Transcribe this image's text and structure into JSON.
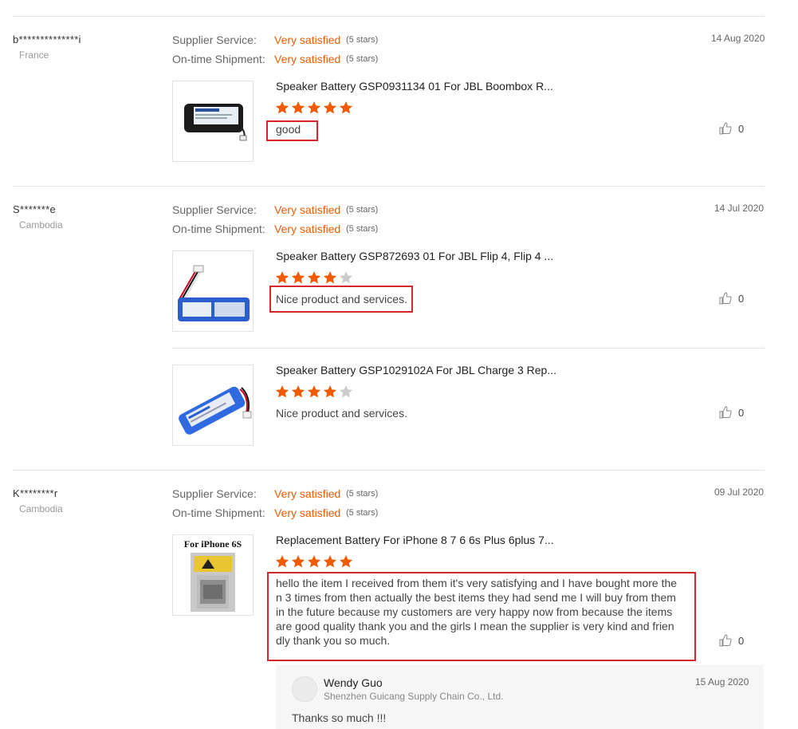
{
  "colors": {
    "accent": "#f05a00",
    "star_on": "#f05a00",
    "star_off": "#cccccc",
    "highlight": "#d6262d"
  },
  "labels": {
    "supplier": "Supplier Service:",
    "shipment": "On-time Shipment:"
  },
  "reviews": [
    {
      "buyer": "b**************i",
      "country": "France",
      "date": "14 Aug 2020",
      "supplier_rating": "Very satisfied",
      "supplier_note": "(5 stars)",
      "shipment_rating": "Very satisfied",
      "shipment_note": "(5 stars)",
      "items": [
        {
          "title": "Speaker Battery GSP0931134 01 For JBL Boombox R...",
          "rating": 5,
          "comment": "good",
          "likes": "0",
          "image": "black-battery"
        }
      ]
    },
    {
      "buyer": "S*******e",
      "country": "Cambodia",
      "date": "14 Jul 2020",
      "supplier_rating": "Very satisfied",
      "supplier_note": "(5 stars)",
      "shipment_rating": "Very satisfied",
      "shipment_note": "(5 stars)",
      "items": [
        {
          "title": "Speaker Battery GSP872693 01 For JBL Flip 4, Flip 4 ...",
          "rating": 4,
          "comment": "Nice product and services.",
          "likes": "0",
          "image": "blue-battery"
        },
        {
          "title": "Speaker Battery GSP1029102A For JBL Charge 3 Rep...",
          "rating": 4,
          "comment": "Nice product and services.",
          "likes": "0",
          "image": "blue-battery-2"
        }
      ]
    },
    {
      "buyer": "K********r",
      "country": "Cambodia",
      "date": "09 Jul 2020",
      "supplier_rating": "Very satisfied",
      "supplier_note": "(5 stars)",
      "shipment_rating": "Very satisfied",
      "shipment_note": "(5 stars)",
      "items": [
        {
          "title": "Replacement Battery For iPhone 8 7 6 6s Plus 6plus 7...",
          "rating": 5,
          "comment_lines": [
            "hello the item I received from them it's very satisfying and I have bought more the",
            "n 3 times from then actually the best items they had send me I will buy from them",
            "in the future because my customers are very happy now from because the items",
            "are good quality  thank you and the girls I mean the supplier is very kind and frien",
            "dly thank you so much."
          ],
          "likes": "0",
          "image": "iphone-battery",
          "image_label": "For iPhone 6S"
        }
      ],
      "reply": {
        "name": "Wendy Guo",
        "company": "Shenzhen Guicang Supply Chain Co., Ltd.",
        "date": "15 Aug 2020",
        "text": "Thanks so much !!!"
      }
    }
  ]
}
